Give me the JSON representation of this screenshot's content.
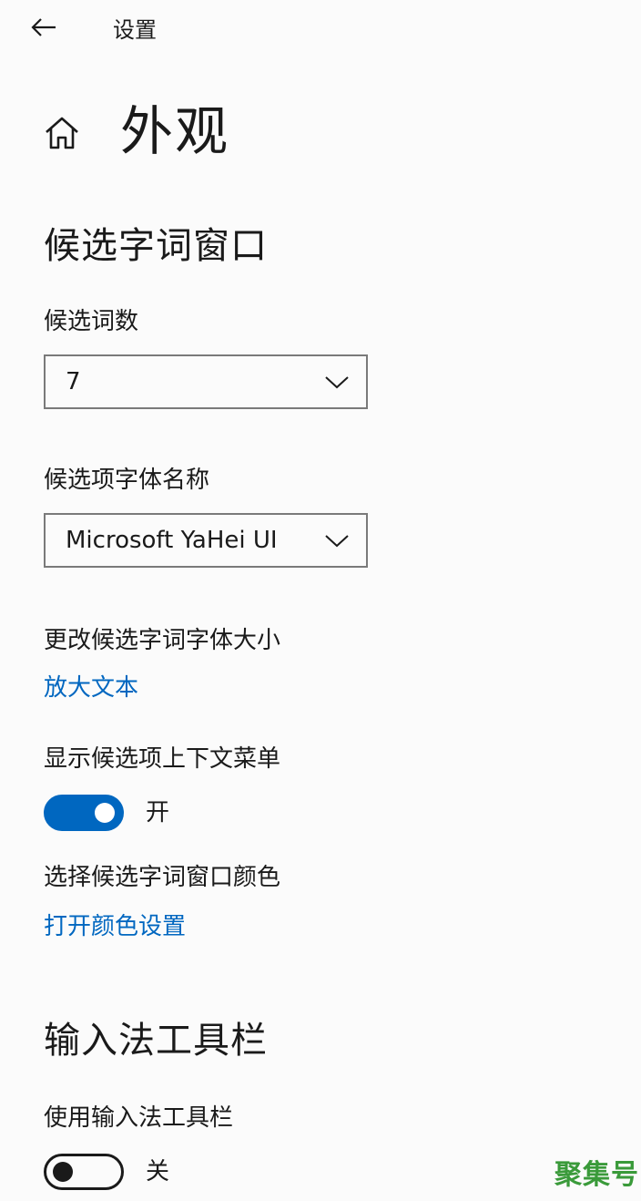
{
  "header": {
    "back_icon": "arrow-left-icon",
    "title": "设置"
  },
  "page": {
    "home_icon": "home-icon",
    "title": "外观"
  },
  "candidate_window": {
    "section_title": "候选字词窗口",
    "count": {
      "label": "候选词数",
      "value": "7"
    },
    "font_name": {
      "label": "候选项字体名称",
      "value": "Microsoft YaHei UI"
    },
    "font_size": {
      "label": "更改候选字词字体大小",
      "link": "放大文本"
    },
    "context_menu": {
      "label": "显示候选项上下文菜单",
      "state": "开",
      "on": true
    },
    "color": {
      "label": "选择候选字词窗口颜色",
      "link": "打开颜色设置"
    }
  },
  "ime_toolbar": {
    "section_title": "输入法工具栏",
    "use_toolbar": {
      "label": "使用输入法工具栏",
      "state": "关",
      "on": false
    }
  },
  "colors": {
    "accent": "#0067c0",
    "background": "#fbfbfb",
    "text": "#1a1a1a",
    "watermark": "#3a9a3a"
  },
  "watermark": "聚集号"
}
